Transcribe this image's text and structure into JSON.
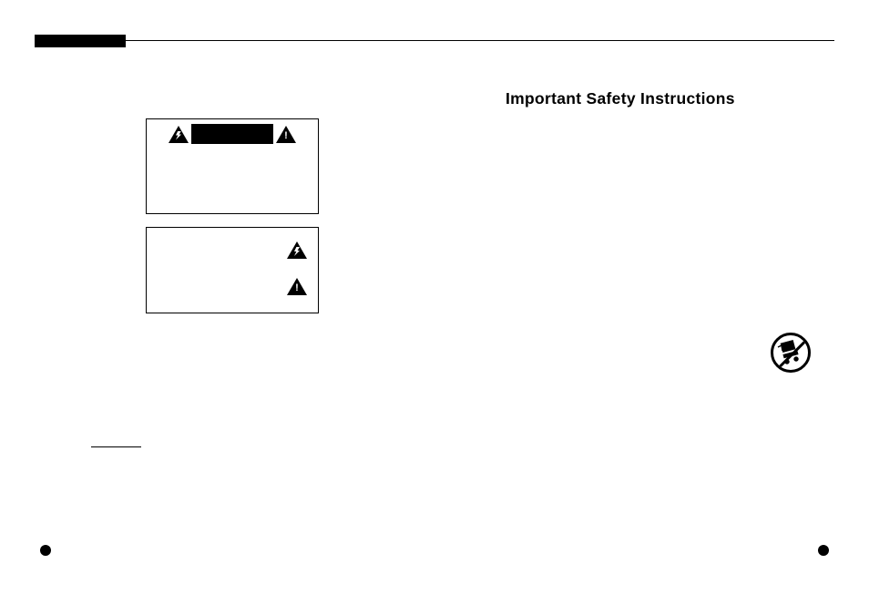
{
  "heading": "Important Safety Instructions",
  "icons": {
    "shock": "lightning-bolt-triangle",
    "warning": "exclamation-triangle",
    "cart": "tipping-cart-prohibited"
  }
}
